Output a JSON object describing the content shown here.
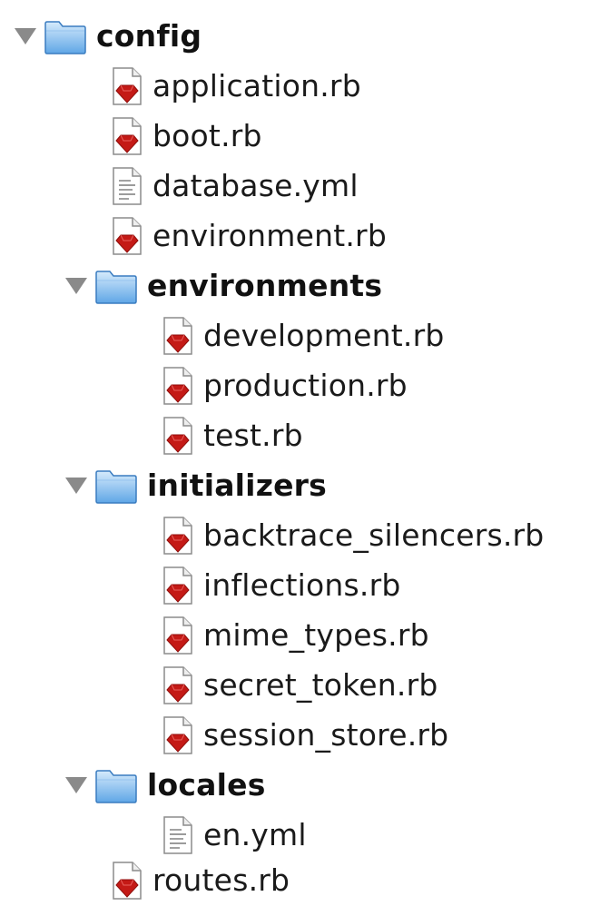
{
  "colors": {
    "folder_top": "#cfe6fb",
    "folder_bottom": "#5fa6e6",
    "folder_stroke": "#3a7cc0",
    "ruby_red": "#c41a16",
    "triangle": "#8a8a8a"
  },
  "tree": {
    "root": {
      "label": "config",
      "icon": "folder-icon",
      "expanded": true
    },
    "application": {
      "label": "application.rb",
      "icon": "ruby-file-icon"
    },
    "boot": {
      "label": "boot.rb",
      "icon": "ruby-file-icon"
    },
    "database": {
      "label": "database.yml",
      "icon": "text-file-icon"
    },
    "environment": {
      "label": "environment.rb",
      "icon": "ruby-file-icon"
    },
    "environments": {
      "label": "environments",
      "icon": "folder-icon",
      "expanded": true
    },
    "development": {
      "label": "development.rb",
      "icon": "ruby-file-icon"
    },
    "production": {
      "label": "production.rb",
      "icon": "ruby-file-icon"
    },
    "test": {
      "label": "test.rb",
      "icon": "ruby-file-icon"
    },
    "initializers": {
      "label": "initializers",
      "icon": "folder-icon",
      "expanded": true
    },
    "backtrace": {
      "label": "backtrace_silencers.rb",
      "icon": "ruby-file-icon"
    },
    "inflections": {
      "label": "inflections.rb",
      "icon": "ruby-file-icon"
    },
    "mime": {
      "label": "mime_types.rb",
      "icon": "ruby-file-icon"
    },
    "secret": {
      "label": "secret_token.rb",
      "icon": "ruby-file-icon"
    },
    "session": {
      "label": "session_store.rb",
      "icon": "ruby-file-icon"
    },
    "locales": {
      "label": "locales",
      "icon": "folder-icon",
      "expanded": true
    },
    "en": {
      "label": "en.yml",
      "icon": "text-file-icon"
    },
    "routes": {
      "label": "routes.rb",
      "icon": "ruby-file-icon"
    }
  }
}
